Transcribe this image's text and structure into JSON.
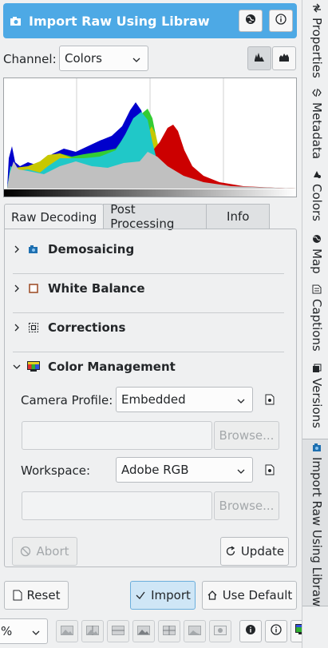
{
  "title_bar": {
    "title": "Import Raw Using Libraw",
    "accent": "#4da9e5"
  },
  "channel": {
    "label": "Channel:",
    "selected": "Colors"
  },
  "histogram": {
    "channel_colors": {
      "red": "#cc0000",
      "green": "#33cc33",
      "blue": "#0000cc",
      "cyan": "#20c8c8",
      "yellow": "#c8c800",
      "luminosity": "#c0c0c0"
    }
  },
  "tabs": [
    {
      "label": "Raw Decoding"
    },
    {
      "label": "Post Processing"
    },
    {
      "label": "Info"
    }
  ],
  "sections": {
    "demosaicing": "Demosaicing",
    "white_balance": "White Balance",
    "corrections": "Corrections",
    "color_management": "Color Management"
  },
  "color_management": {
    "camera_profile_label": "Camera Profile:",
    "camera_profile_value": "Embedded",
    "workspace_label": "Workspace:",
    "workspace_value": "Adobe RGB",
    "browse_label": "Browse..."
  },
  "buttons": {
    "abort": "Abort",
    "update": "Update",
    "reset": "Reset",
    "import": "Import",
    "use_default": "Use Default"
  },
  "toolbar": {
    "zoom_fragment": "%"
  },
  "sidebar": [
    {
      "label": "Properties",
      "icon": "properties-icon"
    },
    {
      "label": "Metadata",
      "icon": "code-icon"
    },
    {
      "label": "Colors",
      "icon": "colors-icon"
    },
    {
      "label": "Map",
      "icon": "globe-icon"
    },
    {
      "label": "Captions",
      "icon": "captions-icon"
    },
    {
      "label": "Versions",
      "icon": "versions-icon"
    },
    {
      "label": "Import Raw Using Libraw",
      "icon": "camera-icon"
    }
  ]
}
